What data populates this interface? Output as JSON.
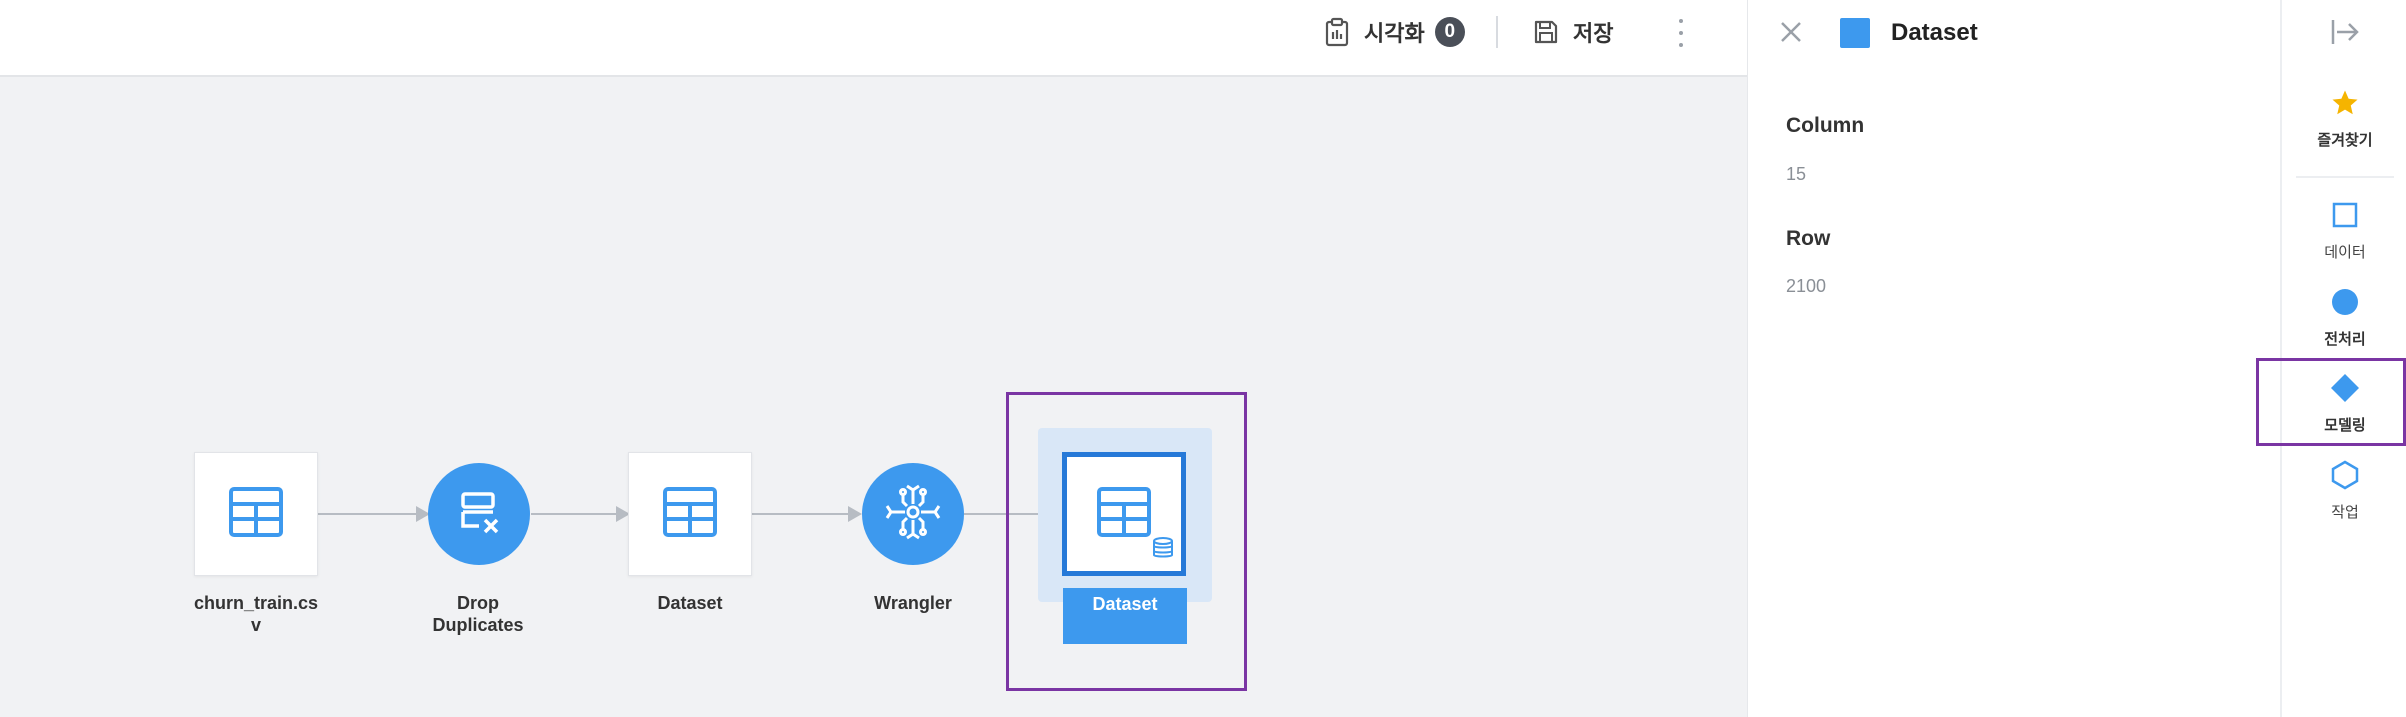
{
  "toolbar": {
    "visualize_label": "시각화",
    "visualize_count": "0",
    "save_label": "저장"
  },
  "pipeline": {
    "nodes": [
      {
        "label_line1": "churn_train.cs",
        "label_line2": "v",
        "kind": "table"
      },
      {
        "label_line1": "Drop",
        "label_line2": "Duplicates",
        "kind": "drop-duplicates"
      },
      {
        "label_line1": "Dataset",
        "label_line2": "",
        "kind": "table"
      },
      {
        "label_line1": "Wrangler",
        "label_line2": "",
        "kind": "wrangler"
      },
      {
        "label_line1": "Dataset",
        "label_line2": "",
        "kind": "dataset-selected"
      }
    ]
  },
  "panel": {
    "title": "Dataset",
    "column_label": "Column",
    "column_value": "15",
    "row_label": "Row",
    "row_value": "2100"
  },
  "rail": {
    "favorites": "즐겨찾기",
    "data": "데이터",
    "preprocessing": "전처리",
    "modeling": "모델링",
    "jobs": "작업"
  },
  "colors": {
    "accent": "#3d99ee",
    "selected_border": "#2679d8",
    "highlight": "#7a35a3",
    "star": "#f5b400",
    "canvas_bg": "#f1f2f4"
  }
}
